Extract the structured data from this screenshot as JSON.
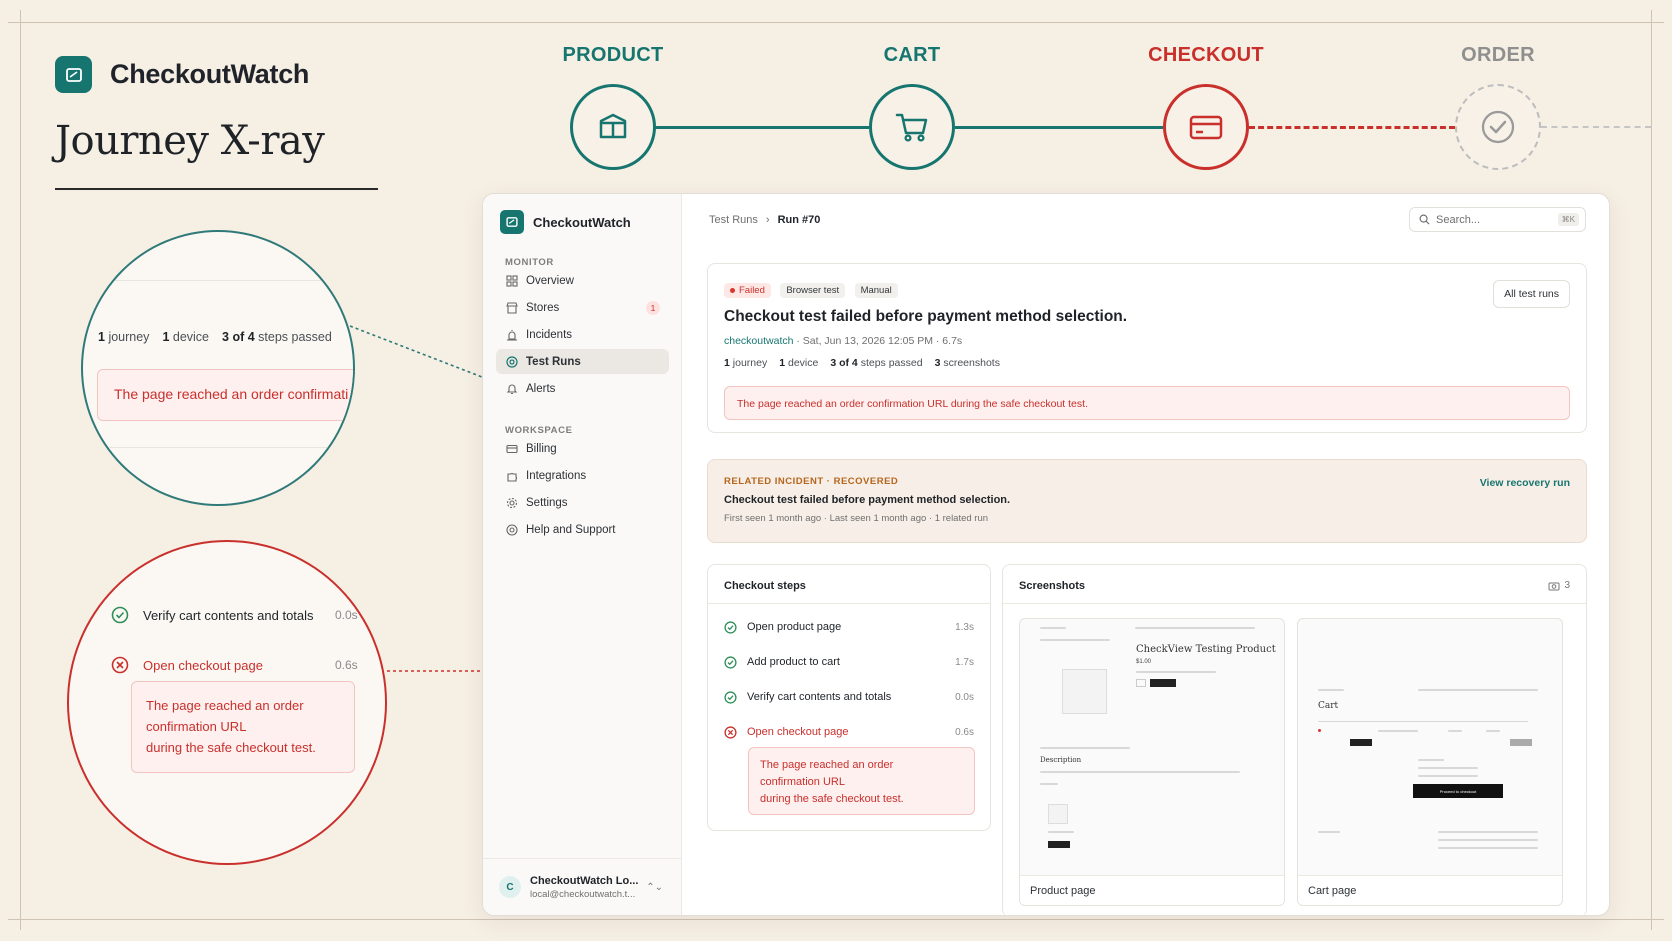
{
  "brand": {
    "name": "CheckoutWatch",
    "title": "Journey X-ray"
  },
  "stages": [
    {
      "label": "PRODUCT",
      "color": "#16766f",
      "icon": "box-icon"
    },
    {
      "label": "CART",
      "color": "#16766f",
      "icon": "cart-icon"
    },
    {
      "label": "CHECKOUT",
      "color": "#c9302c",
      "icon": "credit-card-icon"
    },
    {
      "label": "ORDER",
      "color": "#8f8f8f",
      "icon": "check-circle-icon"
    }
  ],
  "zoom1": {
    "stats": [
      {
        "num": "1",
        "label": "journey"
      },
      {
        "num": "1",
        "label": "device"
      },
      {
        "num": "3 of 4",
        "label": "steps passed"
      }
    ],
    "error": "The page reached an order confirmati"
  },
  "zoom2": {
    "step_pass": {
      "label": "Verify cart contents and totals",
      "dur": "0.0s"
    },
    "step_fail": {
      "label": "Open checkout page",
      "dur": "0.6s"
    },
    "error_lines": [
      "The page reached an order",
      "confirmation URL",
      "during the safe checkout test."
    ]
  },
  "sidebar": {
    "brand": "CheckoutWatch",
    "section_monitor": "MONITOR",
    "section_workspace": "WORKSPACE",
    "monitor_items": [
      {
        "label": "Overview",
        "icon": "grid-icon"
      },
      {
        "label": "Stores",
        "icon": "store-icon",
        "badge": "1"
      },
      {
        "label": "Incidents",
        "icon": "siren-icon"
      },
      {
        "label": "Test Runs",
        "icon": "target-icon",
        "active": true
      },
      {
        "label": "Alerts",
        "icon": "bell-icon"
      }
    ],
    "workspace_items": [
      {
        "label": "Billing",
        "icon": "card-icon"
      },
      {
        "label": "Integrations",
        "icon": "puzzle-icon"
      },
      {
        "label": "Settings",
        "icon": "gear-icon"
      },
      {
        "label": "Help and Support",
        "icon": "lifebuoy-icon"
      }
    ],
    "account": {
      "initial": "C",
      "name": "CheckoutWatch Lo...",
      "email": "local@checkoutwatch.t..."
    }
  },
  "header": {
    "crumb_parent": "Test Runs",
    "crumb_current": "Run #70",
    "search_placeholder": "Search...",
    "search_shortcut": "⌘K"
  },
  "run": {
    "status": "Failed",
    "type": "Browser test",
    "trigger": "Manual",
    "title": "Checkout test failed before payment method selection.",
    "store": "checkoutwatch",
    "meta": "· Sat, Jun 13, 2026 12:05 PM · 6.7s",
    "stats": [
      {
        "num": "1",
        "label": "journey"
      },
      {
        "num": "1",
        "label": "device"
      },
      {
        "num": "3 of 4",
        "label": "steps passed"
      },
      {
        "num": "3",
        "label": "screenshots"
      }
    ],
    "error": "The page reached an order confirmation URL during the safe checkout test.",
    "all_runs_button": "All test runs"
  },
  "incident": {
    "label": "RELATED INCIDENT · RECOVERED",
    "title": "Checkout test failed before payment method selection.",
    "meta": "First seen 1 month ago · Last seen 1 month ago · 1 related run",
    "link": "View recovery run"
  },
  "steps_card": {
    "title": "Checkout steps",
    "steps": [
      {
        "label": "Open product page",
        "dur": "1.3s",
        "status": "pass"
      },
      {
        "label": "Add product to cart",
        "dur": "1.7s",
        "status": "pass"
      },
      {
        "label": "Verify cart contents and totals",
        "dur": "0.0s",
        "status": "pass"
      },
      {
        "label": "Open checkout page",
        "dur": "0.6s",
        "status": "fail"
      }
    ],
    "error_lines": [
      "The page reached an order",
      "confirmation URL",
      "during the safe checkout test."
    ]
  },
  "screenshots_card": {
    "title": "Screenshots",
    "count": "3",
    "shots": [
      {
        "caption": "Product page",
        "heading": "CheckView Testing Product",
        "price": "$1.00",
        "section": "Description"
      },
      {
        "caption": "Cart page",
        "heading": "Cart",
        "cta": "Proceed to checkout"
      }
    ]
  },
  "colors": {
    "teal": "#16766f",
    "red": "#c9302c",
    "gray": "#8f8f8f",
    "background": "#f6efe4"
  }
}
